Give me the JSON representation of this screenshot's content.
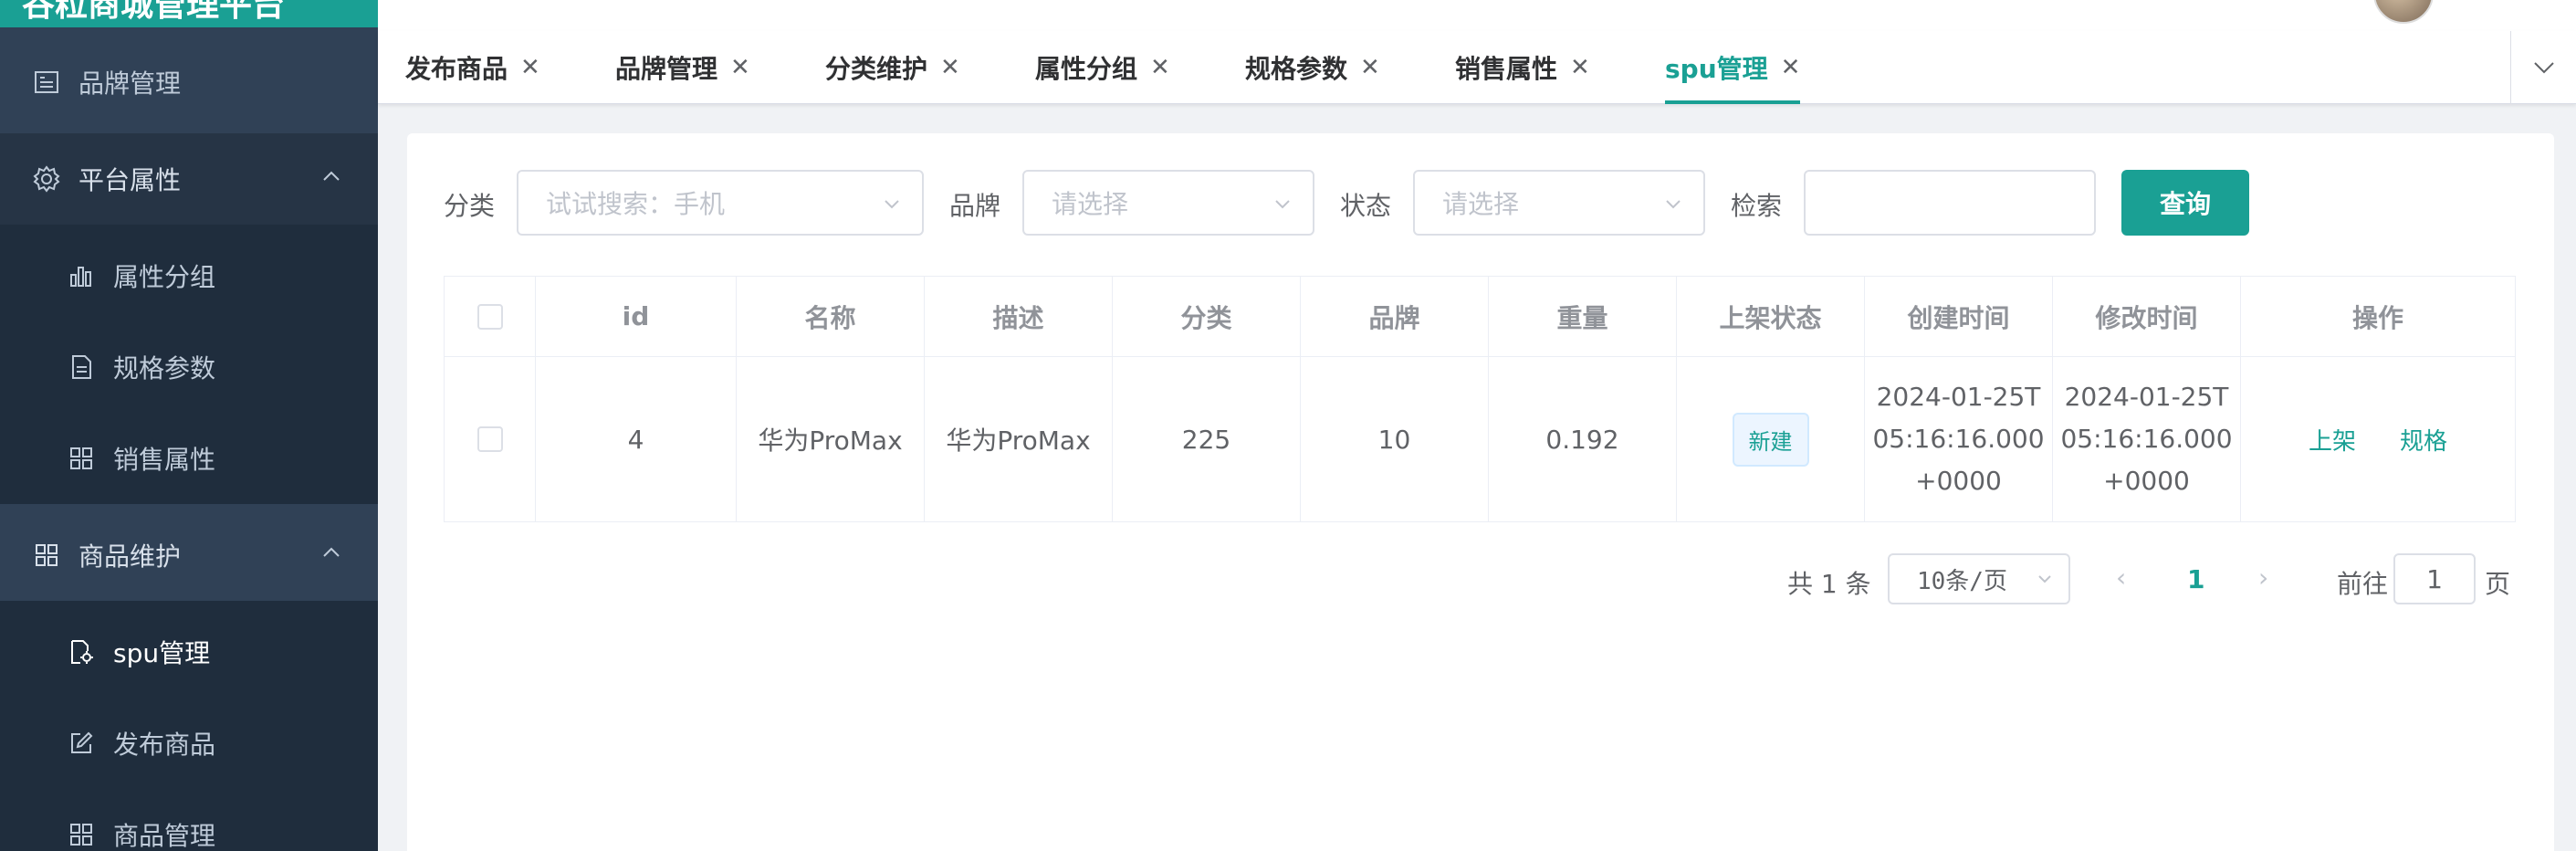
{
  "app": {
    "title": "谷粒商城管理平台"
  },
  "sidebar": {
    "brand_visible": "xx",
    "items": [
      {
        "label": "品牌管理",
        "icon": "brand-icon"
      },
      {
        "label": "平台属性",
        "icon": "gear-icon"
      },
      {
        "label": "属性分组",
        "icon": "bar-chart-icon"
      },
      {
        "label": "规格参数",
        "icon": "document-icon"
      },
      {
        "label": "销售属性",
        "icon": "grid-icon"
      },
      {
        "label": "商品维护",
        "icon": "grid-icon"
      },
      {
        "label": "spu管理",
        "icon": "spu-icon"
      },
      {
        "label": "发布商品",
        "icon": "edit-icon"
      },
      {
        "label": "商品管理",
        "icon": "grid-icon"
      }
    ]
  },
  "tabs": [
    {
      "label": "发布商品",
      "close": "✕"
    },
    {
      "label": "品牌管理",
      "close": "✕"
    },
    {
      "label": "分类维护",
      "close": "✕"
    },
    {
      "label": "属性分组",
      "close": "✕"
    },
    {
      "label": "规格参数",
      "close": "✕"
    },
    {
      "label": "销售属性",
      "close": "✕"
    },
    {
      "label": "spu管理",
      "close": "✕"
    }
  ],
  "filters": {
    "category_label": "分类",
    "category_placeholder": "试试搜索：手机",
    "brand_label": "品牌",
    "brand_placeholder": "请选择",
    "status_label": "状态",
    "status_placeholder": "请选择",
    "search_label": "检索",
    "search_value": "",
    "query_button": "查询"
  },
  "table": {
    "headers": [
      "id",
      "名称",
      "描述",
      "分类",
      "品牌",
      "重量",
      "上架状态",
      "创建时间",
      "修改时间",
      "操作"
    ],
    "rows": [
      {
        "id": "4",
        "name": "华为ProMax",
        "desc": "华为ProMax",
        "category": "225",
        "brand": "10",
        "weight": "0.192",
        "status": "新建",
        "created": "2024-01-25T 05:16:16.000 +0000",
        "modified": "2024-01-25T 05:16:16.000 +0000",
        "actions": [
          "上架",
          "规格"
        ]
      }
    ]
  },
  "pagination": {
    "total": "共 1 条",
    "page_size": "10条/页",
    "current": "1",
    "goto_label": "前往",
    "goto_value": "1",
    "page_suffix": "页"
  },
  "colors": {
    "accent": "#1aa094",
    "sidebar": "#304156",
    "sidebar_sub": "#1f2d3d"
  }
}
